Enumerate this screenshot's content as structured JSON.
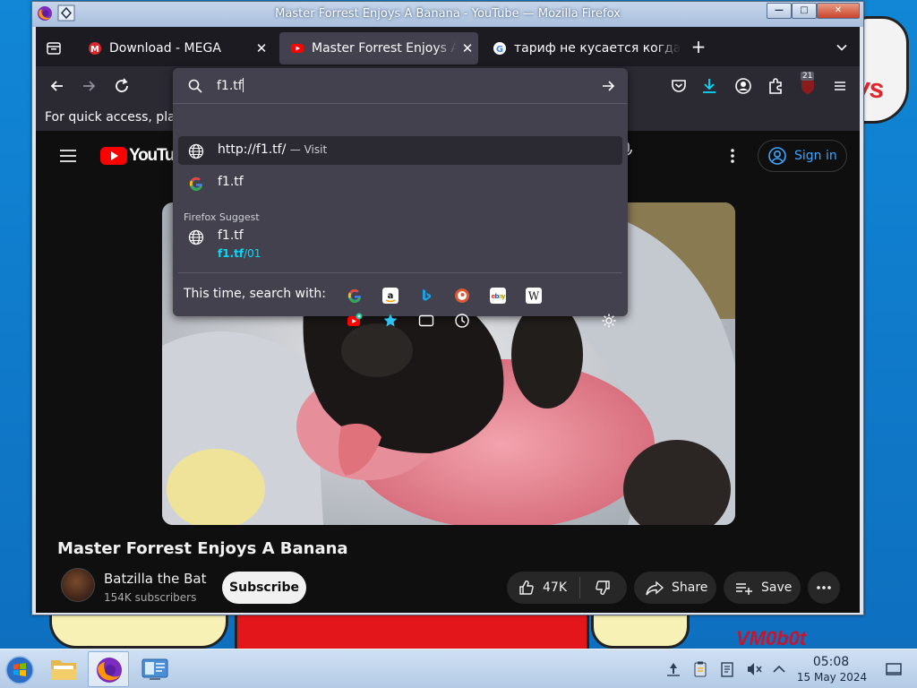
{
  "window": {
    "title": "Master Forrest Enjoys A Banana - YouTube — Mozilla Firefox"
  },
  "tabs": [
    {
      "label": "Download - MEGA",
      "active": false
    },
    {
      "label": "Master Forrest Enjoys A Banana",
      "active": true
    },
    {
      "label": "тариф не кусается когда",
      "active": false
    }
  ],
  "toolbar": {
    "extensions_badge": "21"
  },
  "bookmarks_bar": {
    "hint": "For quick access, place your bookmarks here on the bookmarks toolbar."
  },
  "urlbar": {
    "input_value": "f1.tf",
    "results": [
      {
        "title": "http://f1.tf/",
        "action": "— Visit",
        "icon": "globe-icon"
      },
      {
        "title": "f1.tf",
        "icon": "google-icon"
      }
    ],
    "suggest_group_label": "Firefox Suggest",
    "suggest_item": {
      "title": "f1.tf",
      "url_domain": "f1.tf",
      "url_path": "/01"
    },
    "search_with_label": "This time, search with:",
    "engines": [
      "google-icon",
      "amazon-icon",
      "bing-icon",
      "duckduckgo-icon",
      "ebay-icon",
      "wikipedia-icon",
      "youtube-icon",
      "bookmarks-icon",
      "tabs-icon",
      "history-icon"
    ]
  },
  "youtube": {
    "logo_text": "YouTube",
    "sign_in": "Sign in",
    "video_title": "Master Forrest Enjoys A Banana",
    "channel_name": "Batzilla the Bat",
    "subscribers": "154K subscribers",
    "subscribe_label": "Subscribe",
    "likes": "47K",
    "share_label": "Share",
    "save_label": "Save"
  },
  "taskbar": {
    "time": "05:08",
    "date": "15 May 2024"
  },
  "desktop": {
    "wallpaper_text": "VM0b0t",
    "wallpaper_red_text": "ys"
  },
  "colors": {
    "accent_cyan": "#00ddff",
    "youtube_red": "#ff0000",
    "firefox_dark": "#1c1b22"
  }
}
